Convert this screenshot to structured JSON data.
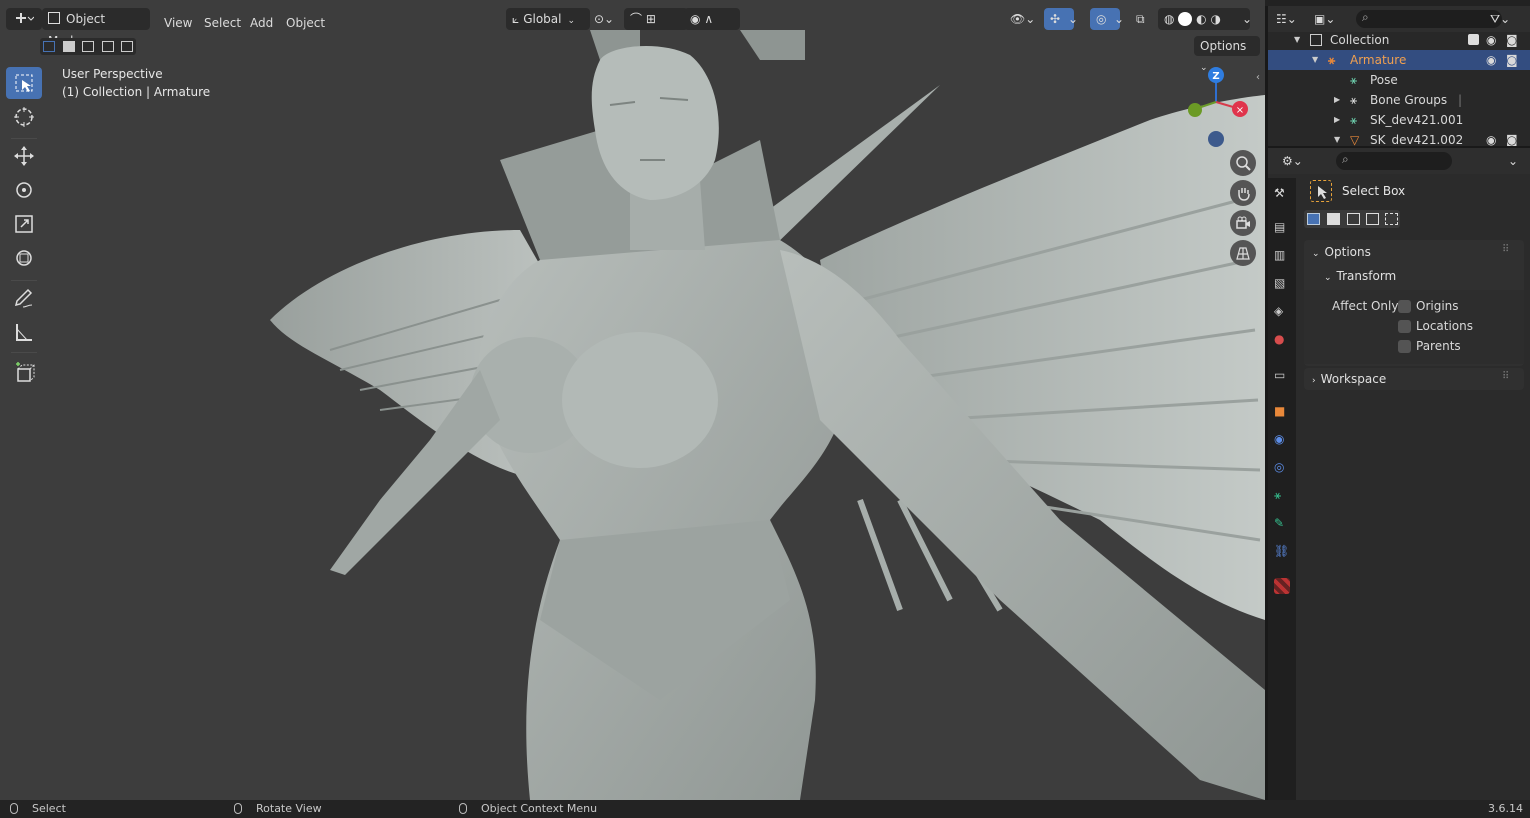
{
  "header": {
    "mode": "Object Mode",
    "menus": [
      "View",
      "Select",
      "Add",
      "Object"
    ],
    "orientation": "Global",
    "options_label": "Options"
  },
  "viewport": {
    "perspective": "User Perspective",
    "context": "(1) Collection | Armature",
    "gizmo_axis": "Z"
  },
  "outliner": {
    "rows": [
      {
        "label": "Collection",
        "icon": "collection-icon"
      },
      {
        "label": "Armature",
        "icon": "armature-icon"
      },
      {
        "label": "Pose",
        "icon": "pose-icon"
      },
      {
        "label": "Bone Groups",
        "icon": "bone-groups-icon"
      },
      {
        "label": "SK_dev421.001",
        "icon": "armature-data-icon"
      },
      {
        "label": "SK_dev421.002",
        "icon": "mesh-icon"
      }
    ]
  },
  "properties": {
    "tool_name": "Select Box",
    "options_label": "Options",
    "transform_label": "Transform",
    "affect_only_label": "Affect Only",
    "checkboxes": [
      "Origins",
      "Locations",
      "Parents"
    ],
    "workspace_label": "Workspace"
  },
  "status_bar": {
    "select": "Select",
    "rotate": "Rotate View",
    "context_menu": "Object Context Menu",
    "version": "3.6.14"
  },
  "colors": {
    "accent": "#4772b3",
    "selected_row": "#334d80",
    "viewport_bg": "#3d3d3d",
    "armature_orange": "#e8883a"
  }
}
